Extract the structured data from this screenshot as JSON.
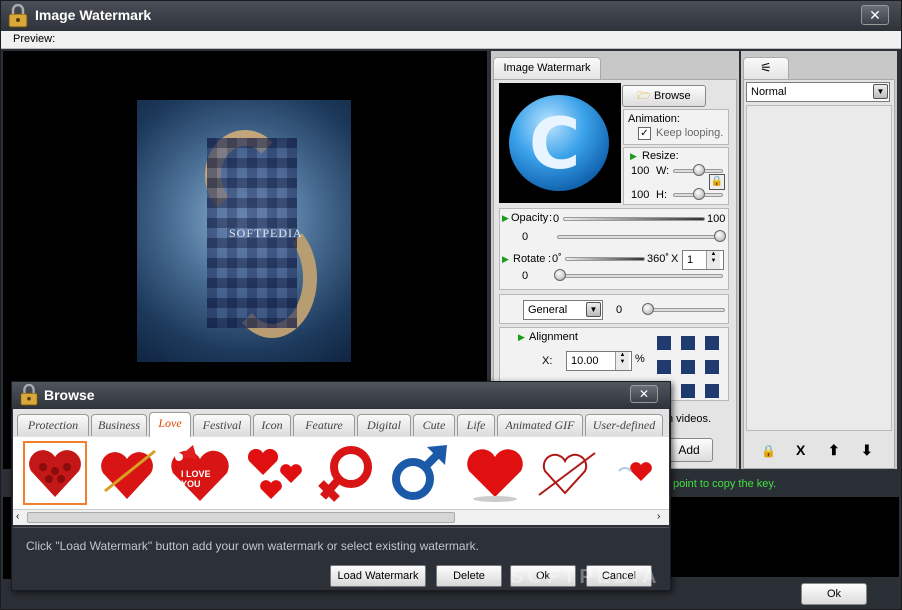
{
  "window": {
    "title": "Image Watermark",
    "close_label": "✕"
  },
  "menu": {
    "preview_label": "Preview:"
  },
  "preview": {
    "image_caption": "SOFTPEDIA"
  },
  "panel": {
    "tab_label": "Image Watermark",
    "browse_label": "Browse",
    "animation_label": "Animation:",
    "keep_looping_label": "Keep looping.",
    "keep_looping_checked": true,
    "resize_label": "Resize:",
    "width_value": "100",
    "width_label": "W:",
    "height_value": "100",
    "height_label": "H:",
    "opacity_label": "Opacity",
    "opacity_min": "0",
    "opacity_max": "100",
    "opacity_value": "0",
    "rotate_label": "Rotate",
    "rotate_min": "0˚",
    "rotate_max": "360˚",
    "rotate_x": "X",
    "rotate_count": "1",
    "rotate_value": "0",
    "blend_select": "General",
    "blend_value": "0",
    "alignment_label": "Alignment",
    "x_label": "X:",
    "x_value": "10.00",
    "percent_label": "%",
    "videos_text": "n videos.",
    "add_label": "Add"
  },
  "format_panel": {
    "select_value": "Normal",
    "icons": [
      "lock-icon",
      "delete-icon",
      "up-arrow-icon",
      "down-arrow-icon"
    ],
    "delete_glyph": "X"
  },
  "status": {
    "green_text": "point to copy the key."
  },
  "ok_label": "Ok",
  "browse_dialog": {
    "title": "Browse",
    "close_label": "✕",
    "tabs": [
      "Protection",
      "Business",
      "Love",
      "Festival",
      "Icon",
      "Feature",
      "Digital",
      "Cute",
      "Life",
      "Animated GIF",
      "User-defined"
    ],
    "active_tab": "Love",
    "thumbnail_texts": {
      "i_love_you": "I LOVE YOU"
    },
    "hint": "Click \"Load Watermark\" button add your own watermark or select existing watermark.",
    "buttons": {
      "load": "Load Watermark",
      "delete": "Delete",
      "ok": "Ok",
      "cancel": "Cancel"
    }
  },
  "watermark_overlay": "SOFTPEDIA",
  "colors": {
    "accent_tab": "#e04000",
    "status_green": "#43e043",
    "heart_red": "#e01010"
  }
}
